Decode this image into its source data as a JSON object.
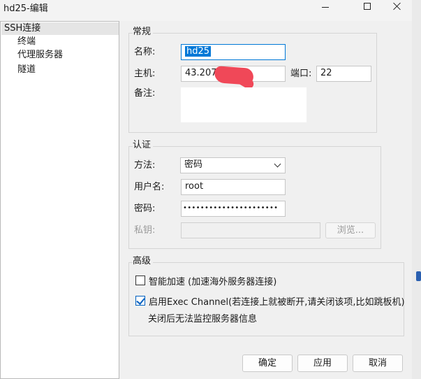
{
  "window": {
    "title": "hd25-编辑"
  },
  "tree": {
    "items": [
      {
        "label": "SSH连接",
        "selected": true
      },
      {
        "label": "终端",
        "selected": false
      },
      {
        "label": "代理服务器",
        "selected": false
      },
      {
        "label": "隧道",
        "selected": false
      }
    ]
  },
  "general": {
    "title": "常规",
    "name_label": "名称:",
    "name_value": "hd25",
    "host_label": "主机:",
    "host_value": "43.207",
    "port_label": "端口:",
    "port_value": "22",
    "note_label": "备注:",
    "note_value": ""
  },
  "auth": {
    "title": "认证",
    "method_label": "方法:",
    "method_value": "密码",
    "user_label": "用户名:",
    "user_value": "root",
    "password_label": "密码:",
    "password_value": "••••••••••••••••••••••",
    "key_label": "私钥:",
    "key_value": "",
    "browse_label": "浏览..."
  },
  "advanced": {
    "title": "高级",
    "smart_accel_label": "智能加速 (加速海外服务器连接)",
    "smart_accel_checked": false,
    "exec_channel_label": "启用Exec Channel(若连接上就被断开,请关闭该项,比如跳板机)",
    "exec_channel_checked": true,
    "exec_note": "关闭后无法监控服务器信息"
  },
  "buttons": {
    "ok": "确定",
    "apply": "应用",
    "cancel": "取消"
  },
  "colors": {
    "selection": "#0078d7",
    "redaction": "#f04858",
    "checkbox_accent": "#0060c0"
  }
}
